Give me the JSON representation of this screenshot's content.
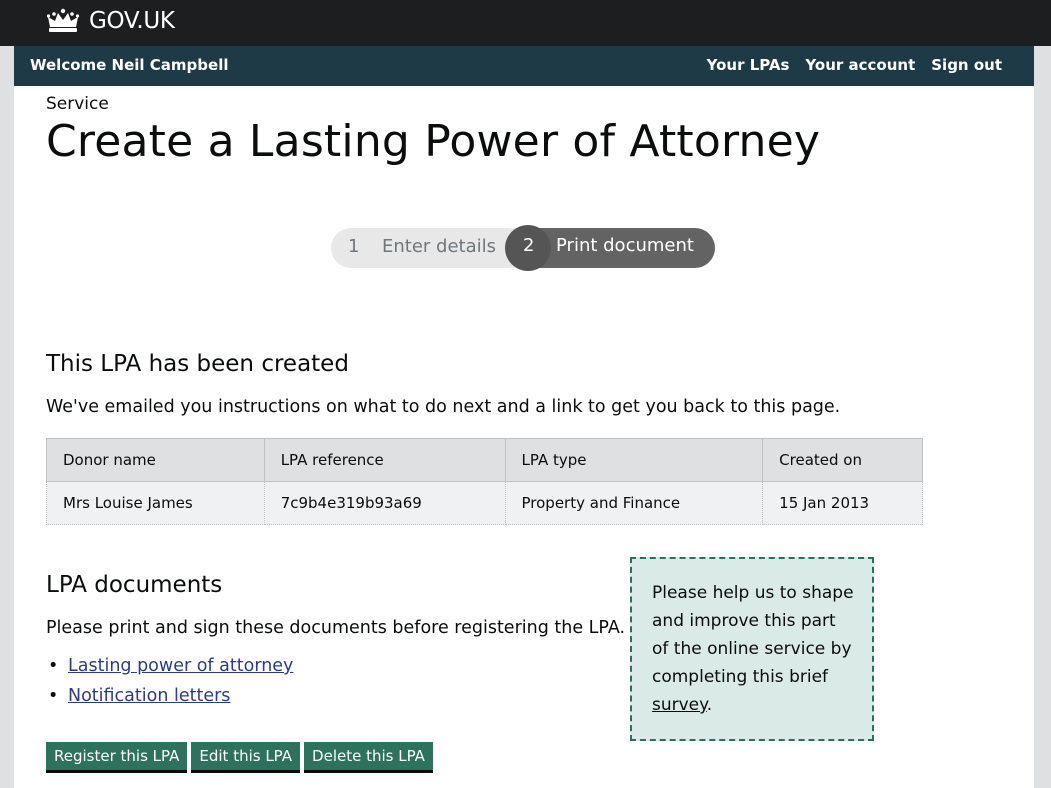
{
  "header": {
    "brand": "GOV.UK",
    "crown_icon": "crown-icon"
  },
  "service_bar": {
    "welcome": "Welcome Neil Campbell",
    "nav": [
      "Your LPAs",
      "Your account",
      "Sign out"
    ]
  },
  "page": {
    "service_label": "Service",
    "title": "Create a Lasting Power of Attorney"
  },
  "steps": [
    {
      "number": "1",
      "label": "Enter details",
      "active": false
    },
    {
      "number": "2",
      "label": "Print document",
      "active": true
    }
  ],
  "created": {
    "heading": "This LPA has been created",
    "message": "We've emailed you instructions on what to do next and a link to get you back to this page."
  },
  "table": {
    "headers": [
      "Donor name",
      "LPA reference",
      "LPA type",
      "Created on"
    ],
    "rows": [
      [
        "Mrs Louise James",
        "7c9b4e319b93a69",
        "Property and Finance",
        "15 Jan 2013"
      ]
    ]
  },
  "documents": {
    "heading": "LPA documents",
    "intro": "Please print and sign these documents before registering the LPA.",
    "links": [
      "Lasting power of attorney",
      "Notification letters"
    ]
  },
  "actions": {
    "register": "Register this LPA",
    "edit": "Edit this LPA",
    "delete": "Delete this LPA"
  },
  "survey": {
    "text": "Please help us to shape and improve this part of the online service by completing this brief ",
    "link": "survey",
    "suffix": "."
  },
  "colors": {
    "header_bg": "#1d1e1f",
    "service_bar_bg": "#1d3a46",
    "button_green": "#2e715d",
    "link_blue": "#2b3d80",
    "survey_bg": "#daeae7"
  }
}
